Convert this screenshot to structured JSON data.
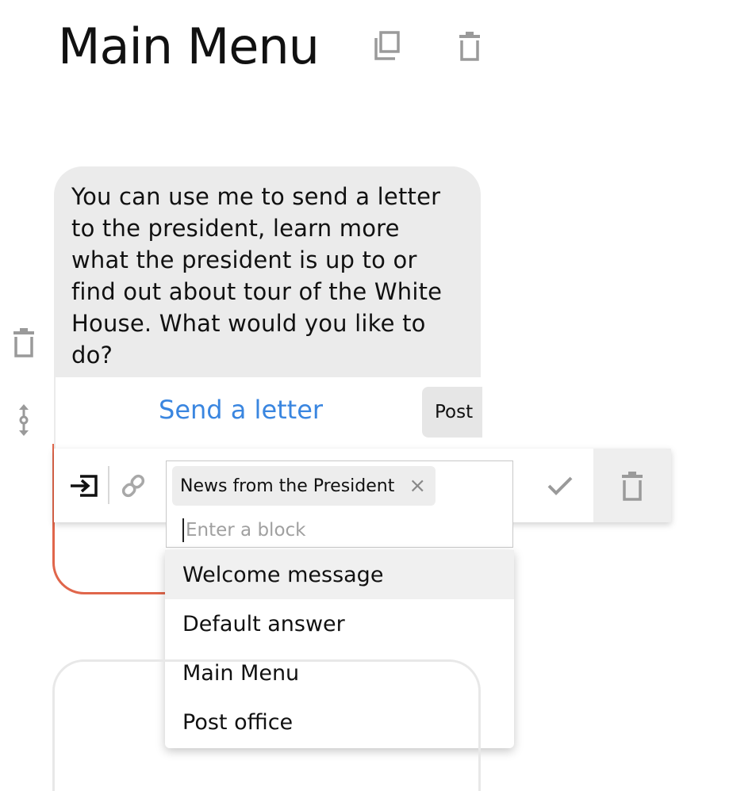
{
  "header": {
    "title": "Main Menu",
    "icons": {
      "copy": "copy-icon",
      "delete": "trash-icon"
    }
  },
  "message": {
    "text": "You can use me to send a letter to the president, learn more what the president is up to or find out about tour of the White House. What would you like to do?"
  },
  "side_icons": {
    "delete": "trash-icon",
    "drag": "drag-handle-icon"
  },
  "quick_replies": [
    {
      "label": "Send a letter"
    },
    {
      "label": "Post"
    }
  ],
  "toolbar": {
    "icons": {
      "enter": "enter-block-icon",
      "link": "link-icon",
      "confirm": "check-icon",
      "delete": "trash-icon"
    }
  },
  "block_picker": {
    "selected_tag": "News from the President",
    "remove_glyph": "×",
    "input_value": "",
    "placeholder": "Enter a block"
  },
  "dropdown": {
    "options": [
      "Welcome message",
      "Default answer",
      "Main Menu",
      "Post office"
    ],
    "highlighted_index": 0
  },
  "colors": {
    "accent_link": "#3a86e0",
    "bubble_bg": "#ebebeb",
    "card_outline_active": "#e0664b",
    "icon_gray": "#9a9a9a"
  }
}
